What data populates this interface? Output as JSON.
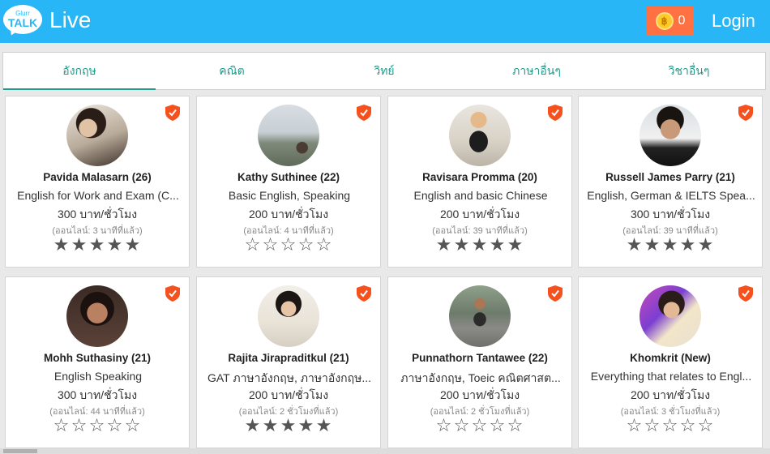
{
  "header": {
    "logo_small": "Glurr",
    "logo_big": "TALK",
    "title": "Live",
    "coins": "0",
    "coin_symbol": "฿",
    "login": "Login",
    "bg": "#29b6f6",
    "coin_bg": "#ff7043"
  },
  "tabs": [
    {
      "label": "อังกฤษ",
      "active": true
    },
    {
      "label": "คณิต"
    },
    {
      "label": "วิทย์"
    },
    {
      "label": "ภาษาอื่นๆ"
    },
    {
      "label": "วิชาอื่นๆ"
    }
  ],
  "tutors": [
    {
      "name": "Pavida Malasarn (26)",
      "subject": "English for Work and Exam (C...",
      "price": "300 บาท/ชั่วโมง",
      "online": "(ออนไลน์: 3 นาทีที่แล้ว)",
      "rating": 5,
      "verified_icon": "shield-check-icon"
    },
    {
      "name": "Kathy Suthinee (22)",
      "subject": "Basic English, Speaking",
      "price": "200 บาท/ชั่วโมง",
      "online": "(ออนไลน์: 4 นาทีที่แล้ว)",
      "rating": 0,
      "verified_icon": "shield-check-icon"
    },
    {
      "name": "Ravisara Promma (20)",
      "subject": "English and basic Chinese",
      "price": "200 บาท/ชั่วโมง",
      "online": "(ออนไลน์: 39 นาทีที่แล้ว)",
      "rating": 5,
      "verified_icon": "shield-check-icon"
    },
    {
      "name": "Russell James Parry (21)",
      "subject": "English, German & IELTS Spea...",
      "price": "300 บาท/ชั่วโมง",
      "online": "(ออนไลน์: 39 นาทีที่แล้ว)",
      "rating": 5,
      "verified_icon": "shield-check-icon"
    },
    {
      "name": "Mohh Suthasiny (21)",
      "subject": "English Speaking",
      "price": "300 บาท/ชั่วโมง",
      "online": "(ออนไลน์: 44 นาทีที่แล้ว)",
      "rating": 0,
      "verified_icon": "shield-check-icon"
    },
    {
      "name": "Rajita Jirapraditkul (21)",
      "subject": "GAT ภาษาอังกฤษ, ภาษาอังกฤษ...",
      "price": "200 บาท/ชั่วโมง",
      "online": "(ออนไลน์: 2 ชั่วโมงที่แล้ว)",
      "rating": 5,
      "verified_icon": "shield-check-icon"
    },
    {
      "name": "Punnathorn Tantawee (22)",
      "subject": "ภาษาอังกฤษ, Toeic คณิตศาสต...",
      "price": "200 บาท/ชั่วโมง",
      "online": "(ออนไลน์: 2 ชั่วโมงที่แล้ว)",
      "rating": 0,
      "verified_icon": "shield-check-icon"
    },
    {
      "name": "Khomkrit (New)",
      "subject": "Everything that relates to Engl...",
      "price": "200 บาท/ชั่วโมง",
      "online": "(ออนไลน์: 3 ชั่วโมงที่แล้ว)",
      "rating": 0,
      "verified_icon": "shield-check-icon"
    }
  ],
  "colors": {
    "accent": "#1e9a8a",
    "shield": "#f4511e",
    "star": "#555555"
  }
}
